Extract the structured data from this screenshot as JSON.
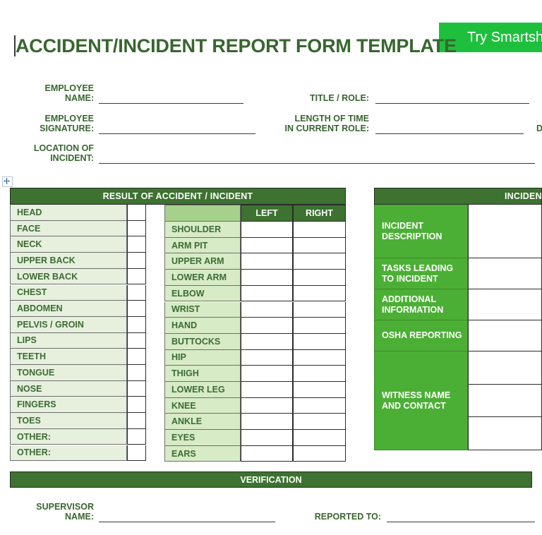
{
  "document": {
    "title": "ACCIDENT/INCIDENT REPORT FORM TEMPLATE"
  },
  "cta": {
    "label": "Try Smartsheet",
    "color": "#1fbf3e"
  },
  "header_fields": [
    {
      "label_line1": "EMPLOYEE",
      "label_line2": "NAME:"
    },
    {
      "label_line1": "TITLE / ROLE:",
      "label_line2": ""
    },
    {
      "label_line1": "EMPLOYEE",
      "label_line2": "SIGNATURE:"
    },
    {
      "label_line1": "LENGTH OF TIME",
      "label_line2": "IN CURRENT ROLE:"
    },
    {
      "label_line1": "D",
      "label_line2": ""
    },
    {
      "label_line1": "LOCATION OF",
      "label_line2": "INCIDENT:"
    }
  ],
  "result_table": {
    "title": "RESULT OF ACCIDENT / INCIDENT",
    "left_column": {
      "rows": [
        "HEAD",
        "FACE",
        "NECK",
        "UPPER BACK",
        "LOWER BACK",
        "CHEST",
        "ABDOMEN",
        "PELVIS / GROIN",
        "LIPS",
        "TEETH",
        "TONGUE",
        "NOSE",
        "FINGERS",
        "TOES",
        "OTHER:",
        "OTHER:"
      ]
    },
    "right_column": {
      "headers": [
        "",
        "LEFT",
        "RIGHT"
      ],
      "rows": [
        "SHOULDER",
        "ARM PIT",
        "UPPER ARM",
        "LOWER ARM",
        "ELBOW",
        "WRIST",
        "HAND",
        "BUTTOCKS",
        "HIP",
        "THIGH",
        "LOWER LEG",
        "KNEE",
        "ANKLE",
        "EYES",
        "EARS"
      ]
    }
  },
  "incident_panel": {
    "title": "INCIDENT",
    "rows": [
      {
        "label": "INCIDENT DESCRIPTION",
        "sublines": 1
      },
      {
        "label": "TASKS LEADING TO INCIDENT",
        "sublines": 1
      },
      {
        "label": "ADDITIONAL INFORMATION",
        "sublines": 1
      },
      {
        "label": "OSHA REPORTING",
        "sublines": 1
      },
      {
        "label": "WITNESS NAME AND CONTACT",
        "sublines": 3
      }
    ]
  },
  "verification": {
    "title": "VERIFICATION",
    "fields": [
      {
        "label_line1": "SUPERVISOR",
        "label_line2": "NAME:"
      },
      {
        "label_line1": "REPORTED TO:",
        "label_line2": ""
      }
    ]
  },
  "colors": {
    "header_dark_green": "#3d7230",
    "label_medium_green": "#4caf35",
    "cell_light_green": "#e6f0dd",
    "cell_mid_green": "#d7ebc6",
    "text_green": "#37662f",
    "cta_green": "#1fbf3e"
  }
}
